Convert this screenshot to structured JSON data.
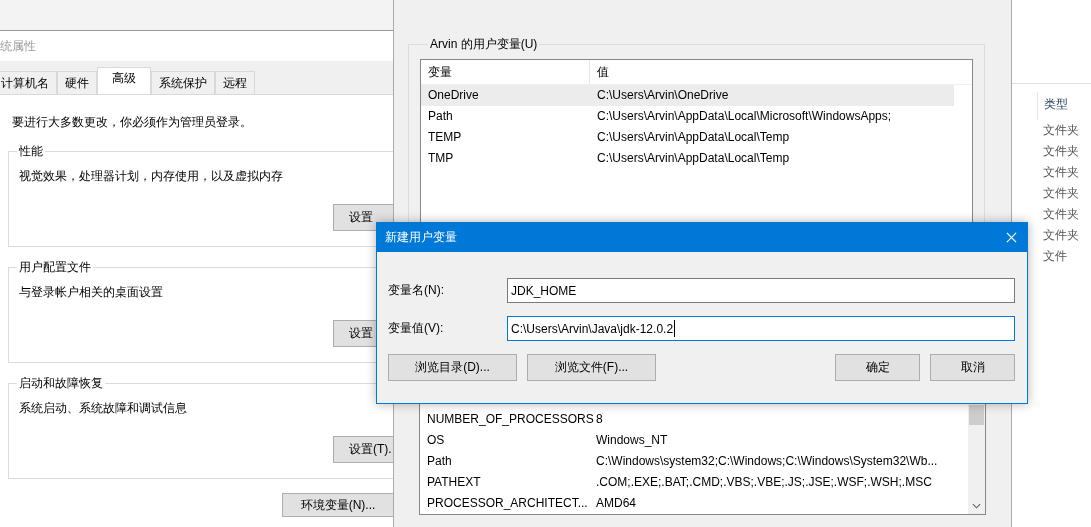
{
  "background_window": {
    "column_header": "类型",
    "rows": [
      "文件夹",
      "文件夹",
      "文件夹",
      "文件夹",
      "文件夹",
      "文件夹",
      "文件"
    ]
  },
  "system_properties": {
    "title": "统属性",
    "tabs": [
      {
        "label": "计算机名",
        "selected": false
      },
      {
        "label": "硬件",
        "selected": false
      },
      {
        "label": "高级",
        "selected": true
      },
      {
        "label": "系统保护",
        "selected": false
      },
      {
        "label": "远程",
        "selected": false
      }
    ],
    "notice": "要进行大多数更改，你必须作为管理员登录。",
    "groups": [
      {
        "title": "性能",
        "description": "视觉效果，处理器计划，内存使用，以及虚拟内存",
        "button": "设置"
      },
      {
        "title": "用户配置文件",
        "description": "与登录帐户相关的桌面设置",
        "button": "设置"
      },
      {
        "title": "启动和故障恢复",
        "description": "系统启动、系统故障和调试信息",
        "button": "设置(T)."
      }
    ],
    "env_button": "环境变量(N)..."
  },
  "environment_variables": {
    "user_group_title": "Arvin 的用户变量(U)",
    "columns": [
      "变量",
      "值"
    ],
    "user_rows": [
      {
        "name": "OneDrive",
        "value": "C:\\Users\\Arvin\\OneDrive",
        "selected": true
      },
      {
        "name": "Path",
        "value": "C:\\Users\\Arvin\\AppData\\Local\\Microsoft\\WindowsApps;",
        "selected": false
      },
      {
        "name": "TEMP",
        "value": "C:\\Users\\Arvin\\AppData\\Local\\Temp",
        "selected": false
      },
      {
        "name": "TMP",
        "value": "C:\\Users\\Arvin\\AppData\\Local\\Temp",
        "selected": false
      }
    ],
    "system_rows": [
      {
        "name": "NUMBER_OF_PROCESSORS",
        "value": "8"
      },
      {
        "name": "OS",
        "value": "Windows_NT"
      },
      {
        "name": "Path",
        "value": "C:\\Windows\\system32;C:\\Windows;C:\\Windows\\System32\\Wb..."
      },
      {
        "name": "PATHEXT",
        "value": ".COM;.EXE;.BAT;.CMD;.VBS;.VBE;.JS;.JSE;.WSF;.WSH;.MSC"
      },
      {
        "name": "PROCESSOR_ARCHITECT...",
        "value": "AMD64"
      }
    ]
  },
  "new_variable_dialog": {
    "title": "新建用户变量",
    "fields": [
      {
        "label": "变量名(N):",
        "value": "JDK_HOME",
        "focused": false
      },
      {
        "label": "变量值(V):",
        "value": "C:\\Users\\Arvin\\Java\\jdk-12.0.2",
        "focused": true
      }
    ],
    "buttons": [
      {
        "label": "浏览目录(D)...",
        "kind": "left"
      },
      {
        "label": "浏览文件(F)...",
        "kind": "left"
      },
      {
        "label": "确定",
        "kind": "right"
      },
      {
        "label": "取消",
        "kind": "right"
      }
    ]
  }
}
